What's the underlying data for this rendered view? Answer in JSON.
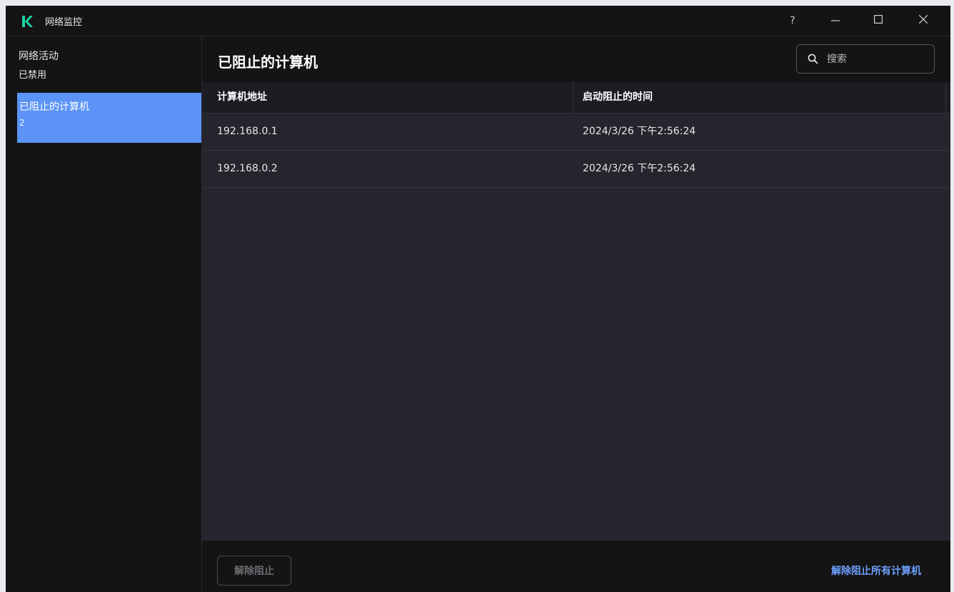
{
  "app": {
    "title": "网络监控",
    "brand_color": "#1bd3a4"
  },
  "window_controls": {
    "help": "?",
    "minimize": "—",
    "maximize": "☐",
    "close": "✕"
  },
  "sidebar": {
    "items": [
      {
        "label": "网络活动",
        "sub": "已禁用",
        "active": false
      },
      {
        "label": "已阻止的计算机",
        "sub": "2",
        "active": true
      }
    ],
    "active_color": "#5b93f6"
  },
  "main": {
    "title": "已阻止的计算机",
    "search": {
      "placeholder": "搜索",
      "value": ""
    },
    "table": {
      "columns": [
        "计算机地址",
        "启动阻止的时间"
      ],
      "rows": [
        [
          "192.168.0.1",
          "2024/3/26 下午2:56:24"
        ],
        [
          "192.168.0.2",
          "2024/3/26 下午2:56:24"
        ]
      ]
    }
  },
  "footer": {
    "unblock_label": "解除阻止",
    "unblock_all_label": "解除阻止所有计算机",
    "link_color": "#6ea0ff"
  }
}
